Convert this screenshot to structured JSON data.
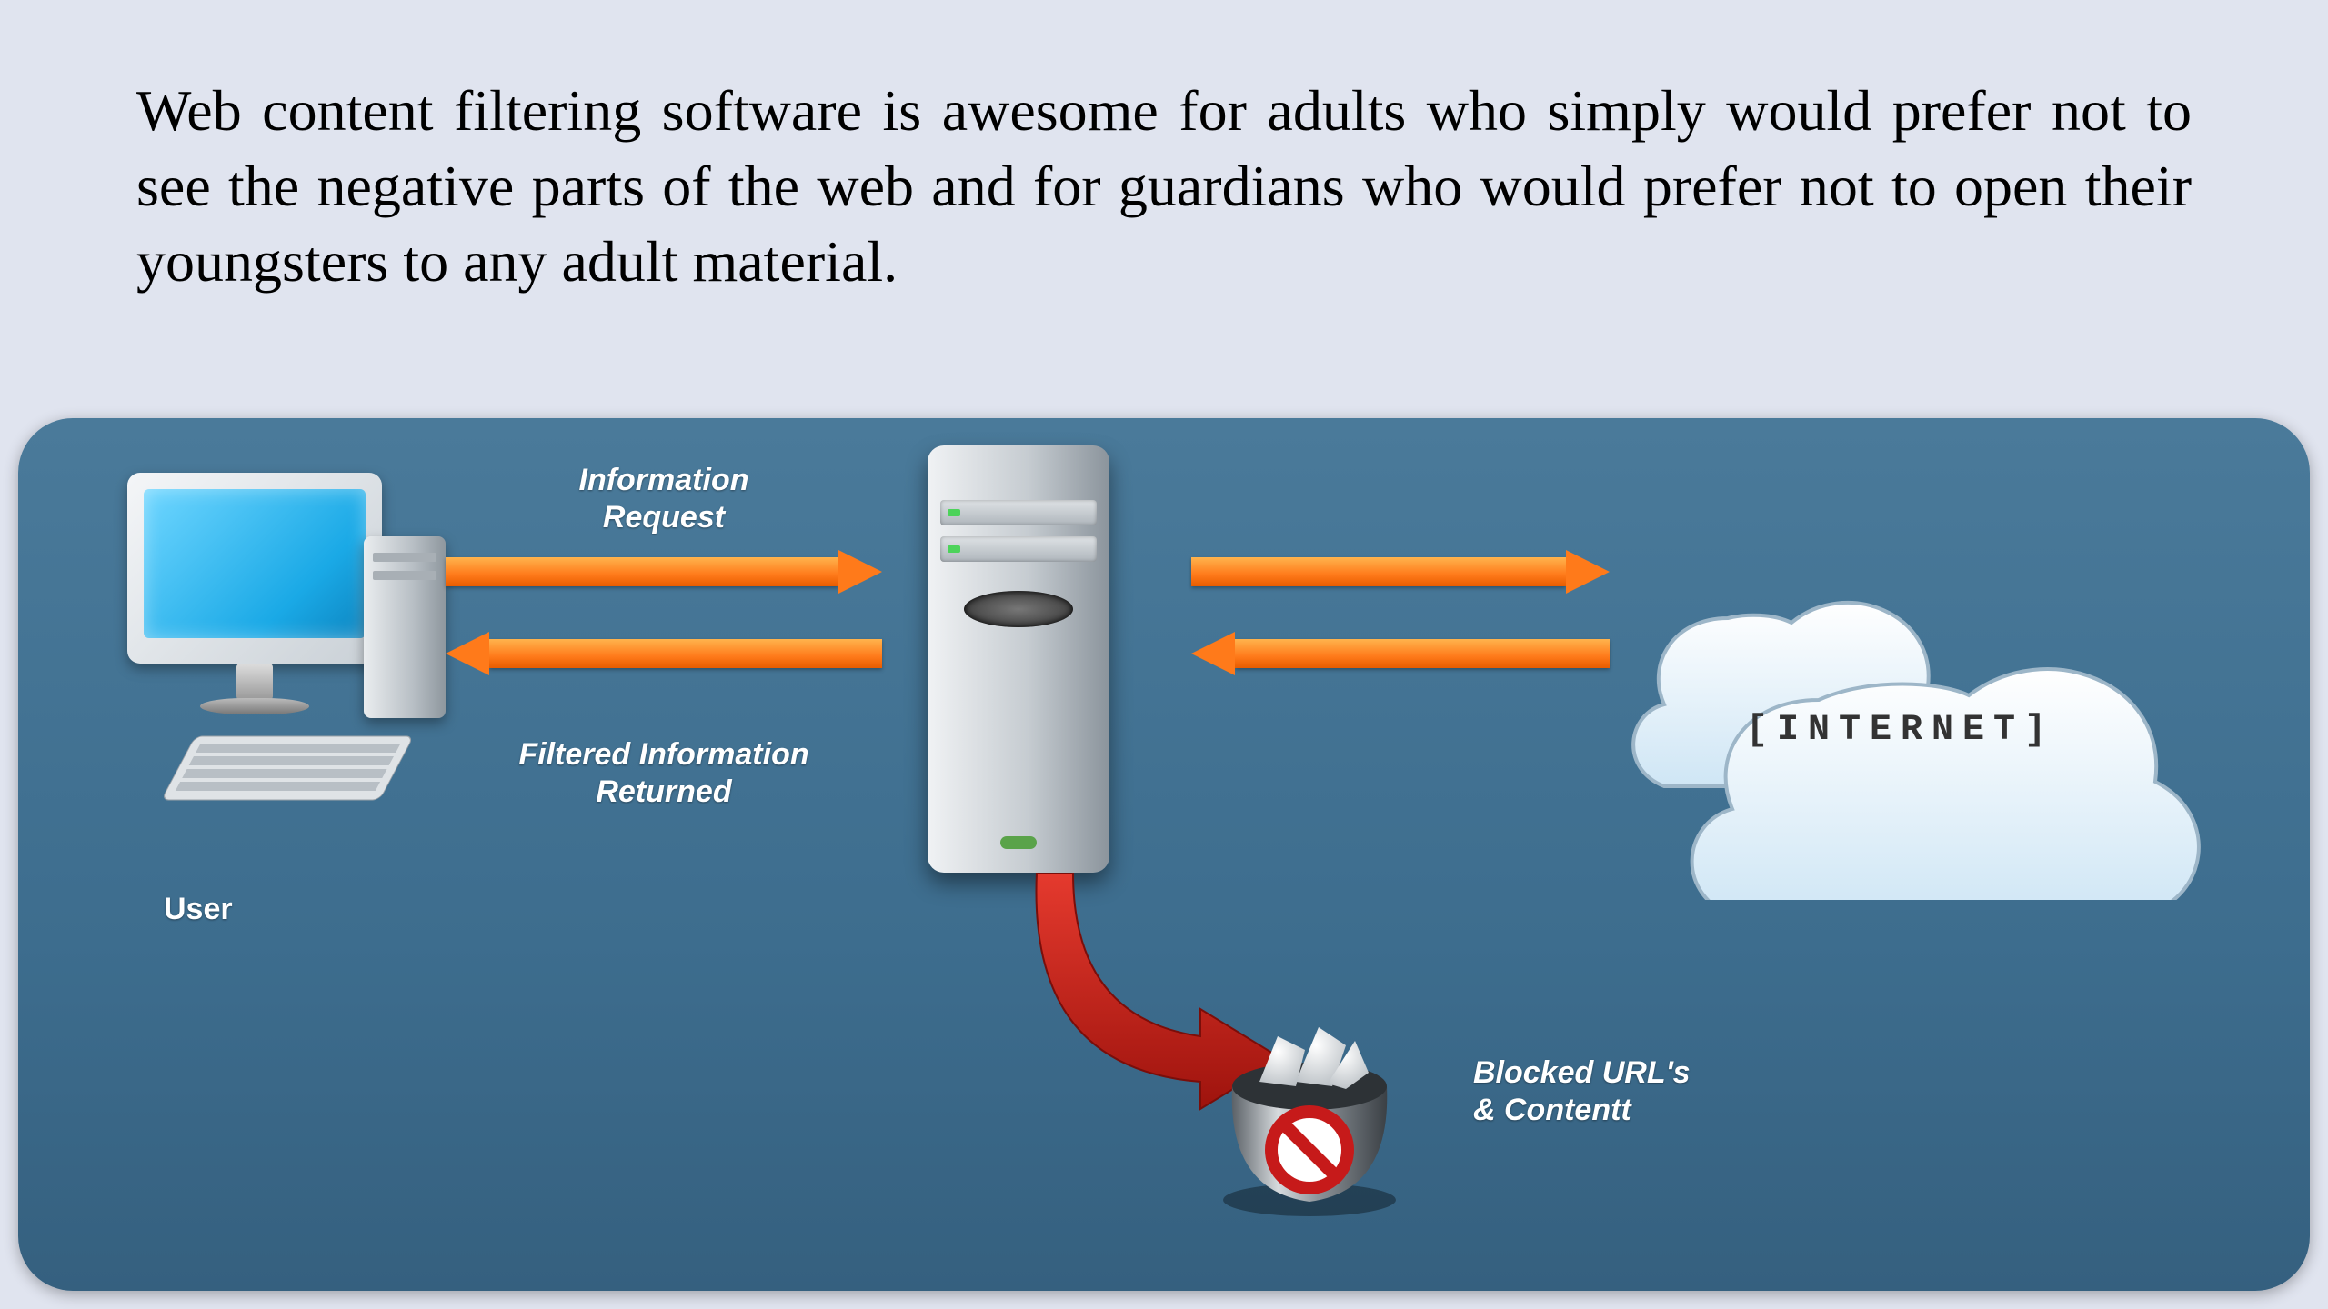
{
  "intro_text": "Web content filtering software is awesome for adults who simply would prefer not to see the negative parts of the web and for guardians who would prefer not to open their youngsters to any adult material.",
  "diagram": {
    "user_label": "User",
    "info_request_label": "Information\nRequest",
    "filtered_return_label": "Filtered Information\nReturned",
    "internet_label": "[INTERNET]",
    "blocked_label": "Blocked URL's\n& Contentt"
  }
}
